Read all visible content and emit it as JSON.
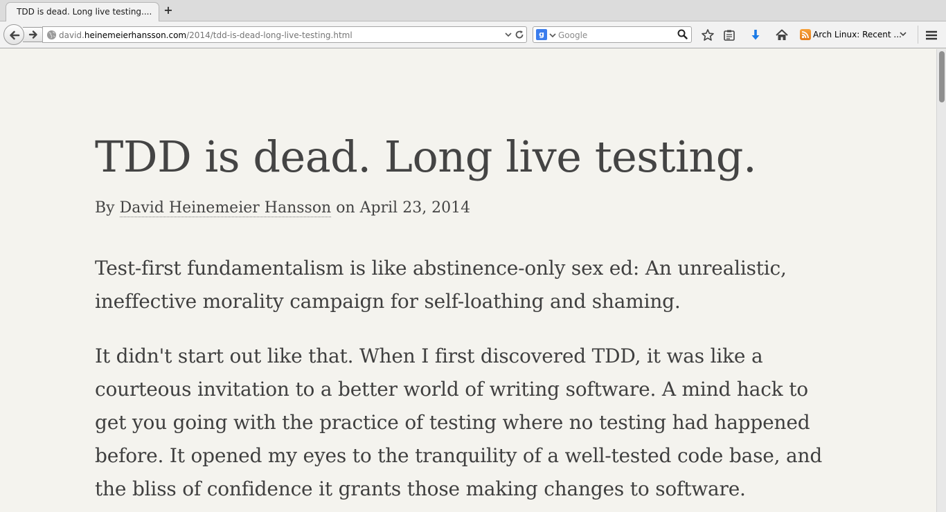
{
  "browser": {
    "tab": {
      "title": "TDD is dead. Long live testing...."
    },
    "new_tab": "+",
    "url": {
      "prefix": "david.",
      "domain": "heinemeierhansson.com",
      "path": "/2014/tdd-is-dead-long-live-testing.html"
    },
    "search": {
      "placeholder": "Google",
      "engine_letter": "g"
    },
    "bookmark": {
      "label": "Arch Linux: Recent ..."
    },
    "colors": {
      "download_arrow": "#1b7ae6",
      "rss": "#ef8f26",
      "search_engine": "#3b7ded"
    }
  },
  "article": {
    "title": "TDD is dead. Long live testing.",
    "byline": {
      "prefix": "By ",
      "author": "David Heinemeier Hansson",
      "middle": " on ",
      "date": "April 23, 2014"
    },
    "paragraphs": [
      "Test-first fundamentalism is like abstinence-only sex ed: An unrealistic, ineffective morality campaign for self-loathing and shaming.",
      "It didn't start out like that. When I first discovered TDD, it was like a courteous invitation to a better world of writing software. A mind hack to get you going with the practice of testing where no testing had happened before. It opened my eyes to the tranquility of a well-tested code base, and the bliss of confidence it grants those making changes to software."
    ]
  }
}
